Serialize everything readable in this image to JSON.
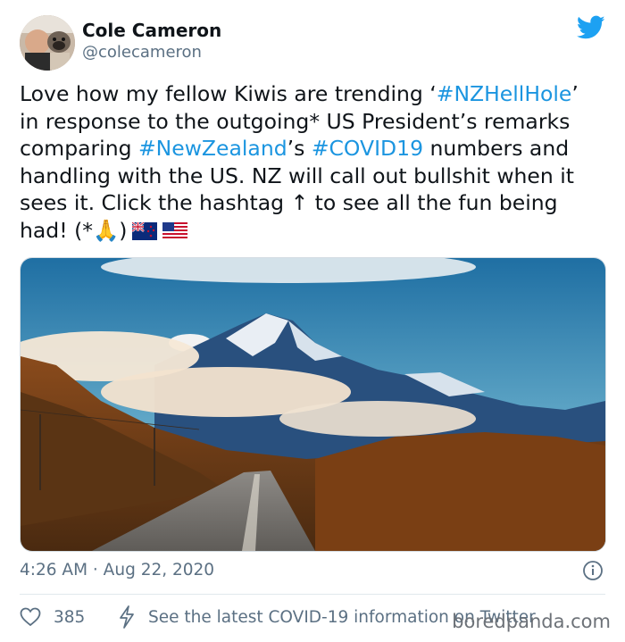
{
  "tweet": {
    "display_name": "Cole Cameron",
    "handle": "@colecameron",
    "text": {
      "p1": "Love how my fellow Kiwis are trending ‘",
      "hashtag1": "#NZHellHole",
      "p2": "’ in response to the outgoing* US President’s remarks comparing ",
      "hashtag2": "#NewZealand",
      "p3": "’s ",
      "hashtag3": "#COVID19",
      "p4": " numbers and handling with the US. NZ will call out bullshit when it sees it. Click the hashtag ↑ to see all the fun being had! (*🙏)"
    },
    "timestamp": "4:26 AM · Aug 22, 2020",
    "likes": "385",
    "covid_link": "See the latest COVID-19 information on Twitter"
  },
  "watermark": "boredpanda.com",
  "icons": {
    "brand": "twitter-bird-icon",
    "info": "info-icon",
    "like": "heart-icon",
    "covid": "lightning-icon"
  },
  "colors": {
    "hashtag": "#1b95e0",
    "secondary_text": "#5b7083",
    "twitter_blue": "#1da1f2",
    "divider": "#e1e8ed"
  }
}
